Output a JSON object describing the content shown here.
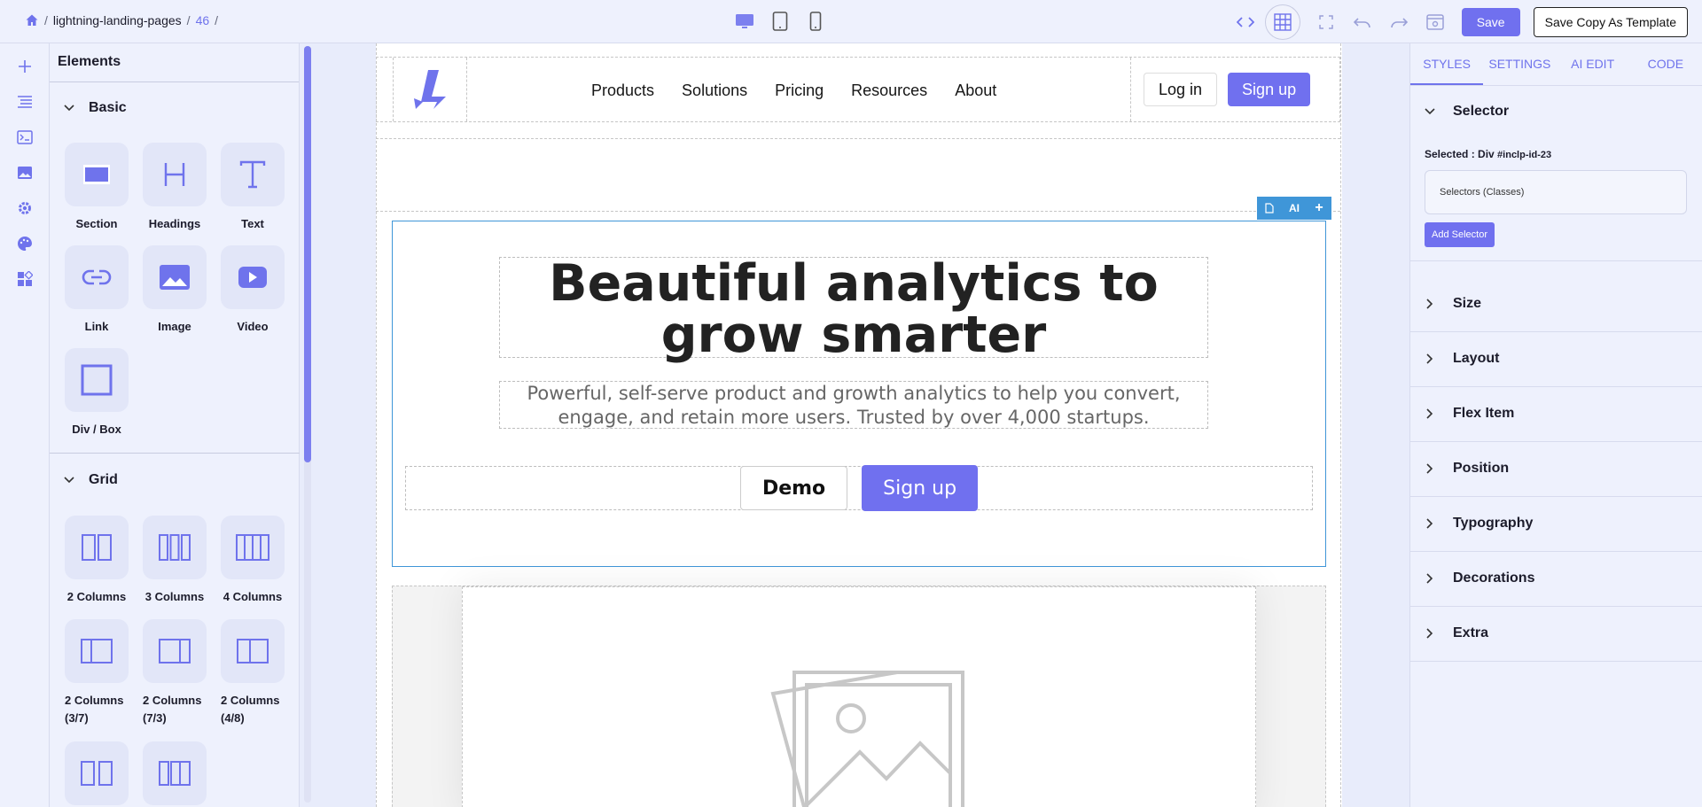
{
  "breadcrumb": {
    "project": "lightning-landing-pages",
    "page": "46"
  },
  "toolbar": {
    "save_label": "Save",
    "save_template_label": "Save Copy As Template"
  },
  "elements_panel": {
    "title": "Elements",
    "basic": {
      "heading": "Basic",
      "items": [
        "Section",
        "Headings",
        "Text",
        "Link",
        "Image",
        "Video",
        "Div / Box"
      ]
    },
    "grid": {
      "heading": "Grid",
      "items": [
        "2 Columns",
        "3 Columns",
        "4 Columns",
        "2 Columns (3/7)",
        "2 Columns (7/3)",
        "2 Columns (4/8)"
      ]
    }
  },
  "canvas": {
    "nav": {
      "menu": [
        "Products",
        "Solutions",
        "Pricing",
        "Resources",
        "About"
      ],
      "login": "Log in",
      "signup": "Sign up"
    },
    "hero": {
      "title": "Beautiful analytics to grow smarter",
      "subtitle": "Powerful, self-serve product and growth analytics to help you convert, engage, and retain more users. Trusted by over 4,000 startups.",
      "demo": "Demo",
      "signup": "Sign up"
    },
    "hero_toolbar": {
      "ai": "AI",
      "plus": "+"
    }
  },
  "right_panel": {
    "tabs": [
      "STYLES",
      "SETTINGS",
      "AI EDIT",
      "CODE"
    ],
    "selector": {
      "heading": "Selector",
      "selected_label": "Selected : Div",
      "selected_id": "#inclp-id-23",
      "input_placeholder": "Selectors (Classes)",
      "add_button": "Add Selector"
    },
    "sections": [
      "Size",
      "Layout",
      "Flex Item",
      "Position",
      "Typography",
      "Decorations",
      "Extra"
    ]
  },
  "colors": {
    "accent": "#7070ef",
    "selection": "#3f96d8",
    "panel_bg": "#eef1fd"
  }
}
